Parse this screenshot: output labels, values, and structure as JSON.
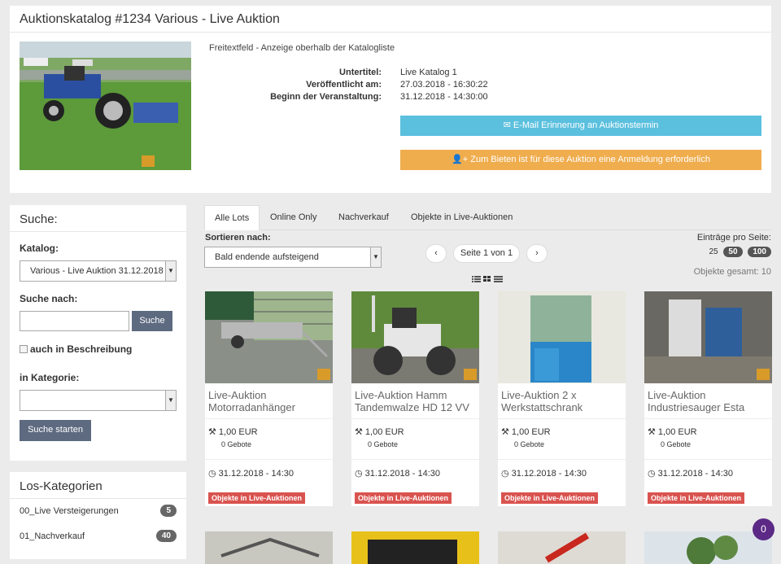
{
  "header": {
    "title": "Auktionskatalog #1234 Various - Live Auktion",
    "free_text": "Freitextfeld - Anzeige oberhalb der Katalogliste",
    "info": [
      {
        "key": "Untertitel:",
        "value": "Live Katalog 1"
      },
      {
        "key": "Veröffentlicht am:",
        "value": "27.03.2018 - 16:30:22"
      },
      {
        "key": "Beginn der Veranstaltung:",
        "value": "31.12.2018 - 14:30:00"
      }
    ],
    "email_button": "E-Mail Erinnerung an Auktionstermin",
    "bid_button": "Zum Bieten ist für diese Auktion eine Anmeldung erforderlich"
  },
  "search": {
    "title": "Suche:",
    "katalog_label": "Katalog:",
    "katalog_value": "Various - Live Auktion 31.12.2018",
    "suche_nach_label": "Suche nach:",
    "search_button": "Suche",
    "checkbox_label": "auch in Beschreibung",
    "kategorie_label": "in Kategorie:",
    "kategorie_value": "",
    "start_button": "Suche starten"
  },
  "categories": {
    "title": "Los-Kategorien",
    "items": [
      {
        "label": "00_Live Versteigerungen",
        "count": "5"
      },
      {
        "label": "01_Nachverkauf",
        "count": "40"
      }
    ]
  },
  "tabs": [
    "Alle Lots",
    "Online Only",
    "Nachverkauf",
    "Objekte in Live-Auktionen"
  ],
  "listing": {
    "sort_label": "Sortieren nach:",
    "sort_value": "Bald endende aufsteigend",
    "page_text": "Seite 1 von 1",
    "per_page_label": "Einträge pro Seite:",
    "per_page_options": [
      "25",
      "50",
      "100"
    ],
    "total": "Objekte gesamt: 10"
  },
  "lots": [
    {
      "title": "Live-Auktion Motorradanhänger",
      "price": "1,00 EUR",
      "bids": "0 Gebote",
      "date": "31.12.2018 - 14:30",
      "tag": "Objekte in Live-Auktionen"
    },
    {
      "title": "Live-Auktion Hamm Tandemwalze HD 12 VV",
      "price": "1,00 EUR",
      "bids": "0 Gebote",
      "date": "31.12.2018 - 14:30",
      "tag": "Objekte in Live-Auktionen"
    },
    {
      "title": "Live-Auktion 2 x Werkstattschrank",
      "price": "1,00 EUR",
      "bids": "0 Gebote",
      "date": "31.12.2018 - 14:30",
      "tag": "Objekte in Live-Auktionen"
    },
    {
      "title": "Live-Auktion Industriesauger Esta",
      "price": "1,00 EUR",
      "bids": "0 Gebote",
      "date": "31.12.2018 - 14:30",
      "tag": "Objekte in Live-Auktionen"
    }
  ],
  "chat": {
    "count": "0"
  },
  "colors": {
    "info": "#5bc0de",
    "warning": "#f0ad4e",
    "danger": "#d9534f",
    "dark_button": "#5d6a80",
    "chat": "#5c2a86"
  }
}
